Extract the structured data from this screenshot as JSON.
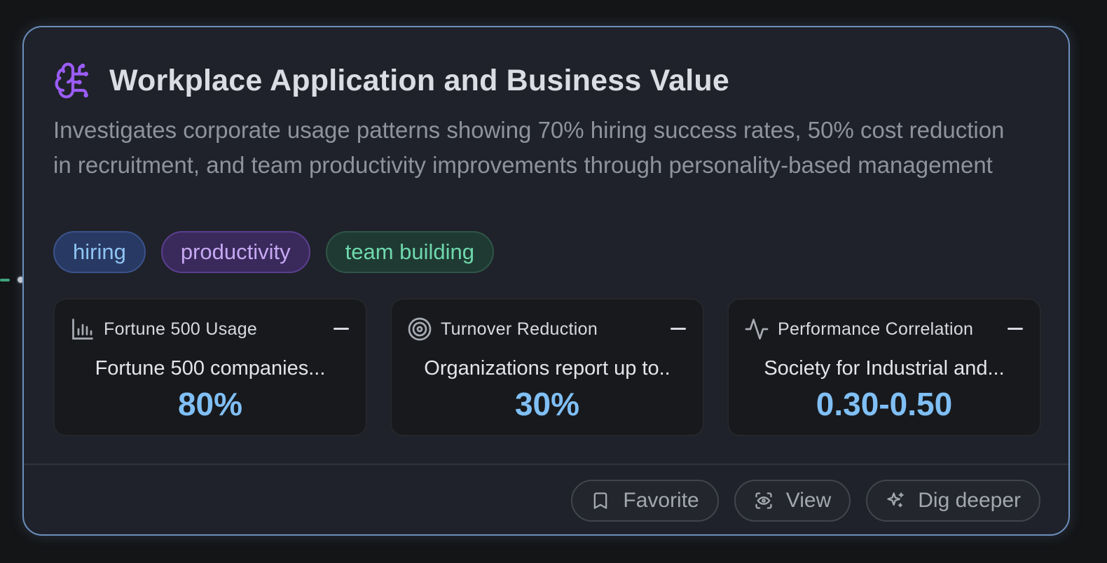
{
  "card": {
    "title": "Workplace Application and Business Value",
    "description": "Investigates corporate usage patterns showing 70% hiring success rates, 50% cost reduction in recruitment, and team productivity improvements through personality-based management",
    "icon": "brain-icon",
    "accent_color": "#6c8fbd"
  },
  "tags": [
    {
      "label": "hiring",
      "color": "#8fc4f4"
    },
    {
      "label": "productivity",
      "color": "#c6a8f2"
    },
    {
      "label": "team building",
      "color": "#6fd8ad"
    }
  ],
  "metrics": [
    {
      "label": "Fortune 500 Usage",
      "icon": "bar-chart-icon",
      "text": "Fortune 500 companies...",
      "value": "80%"
    },
    {
      "label": "Turnover Reduction",
      "icon": "target-icon",
      "text": "Organizations report up to..",
      "value": "30%"
    },
    {
      "label": "Performance Correlation",
      "icon": "pulse-icon",
      "text": "Society for Industrial and...",
      "value": "0.30-0.50"
    }
  ],
  "actions": {
    "favorite": "Favorite",
    "view": "View",
    "dig_deeper": "Dig deeper"
  }
}
